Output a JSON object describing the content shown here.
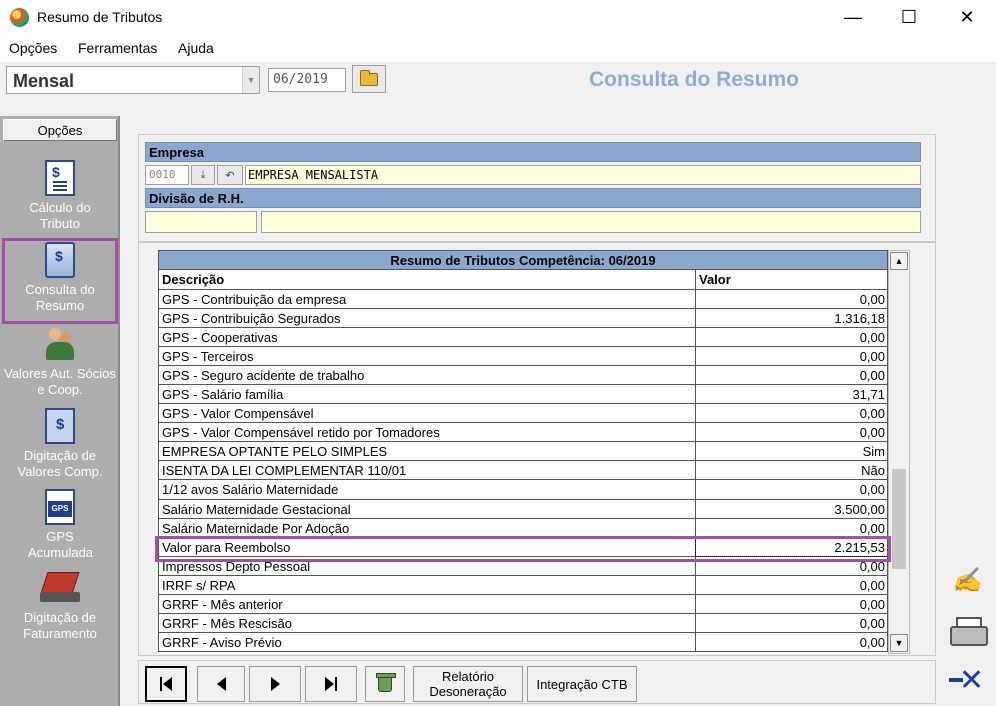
{
  "window": {
    "title": "Resumo de Tributos",
    "minimize": "—",
    "maximize": "☐",
    "close": "✕"
  },
  "menu": [
    "Opções",
    "Ferramentas",
    "Ajuda"
  ],
  "toolbar": {
    "period_type": "Mensal",
    "competence": "06/2019",
    "page_title": "Consulta do Resumo"
  },
  "sidebar": {
    "header": "Opções",
    "items": [
      {
        "label": "Cálculo do Tributo",
        "icon": "calc-tribute-icon"
      },
      {
        "label": "Consulta do Resumo",
        "icon": "consult-summary-icon",
        "selected": true
      },
      {
        "label": "Valores Aut. Sócios e Coop.",
        "icon": "partners-icon"
      },
      {
        "label": "Digitação de Valores Comp.",
        "icon": "compensation-entry-icon"
      },
      {
        "label": "GPS Acumulada",
        "icon": "gps-icon"
      },
      {
        "label": "Digitação de Faturamento",
        "icon": "billing-entry-icon"
      }
    ]
  },
  "form": {
    "empresa_label": "Empresa",
    "empresa_code": "0010",
    "empresa_name": "EMPRESA MENSALISTA",
    "divisao_label": "Divisão de R.H.",
    "divisao_code": "",
    "divisao_name": ""
  },
  "grid": {
    "caption": "Resumo de Tributos Competência: 06/2019",
    "columns": [
      "Descrição",
      "Valor"
    ],
    "rows": [
      {
        "desc": "GPS - Contribuição da empresa",
        "value": "0,00"
      },
      {
        "desc": "GPS - Contribuição Segurados",
        "value": "1.316,18"
      },
      {
        "desc": "GPS - Cooperativas",
        "value": "0,00"
      },
      {
        "desc": "GPS - Terceiros",
        "value": "0,00"
      },
      {
        "desc": "GPS - Seguro acidente de trabalho",
        "value": "0,00"
      },
      {
        "desc": "GPS - Salário família",
        "value": "31,71"
      },
      {
        "desc": "GPS - Valor Compensável",
        "value": "0,00"
      },
      {
        "desc": "GPS - Valor Compensável retido por Tomadores",
        "value": "0,00"
      },
      {
        "desc": "EMPRESA OPTANTE PELO SIMPLES",
        "value": "Sim"
      },
      {
        "desc": "ISENTA DA LEI COMPLEMENTAR 110/01",
        "value": "Não"
      },
      {
        "desc": "1/12 avos Salário Maternidade",
        "value": "0,00"
      },
      {
        "desc": "Salário Maternidade Gestacional",
        "value": "3.500,00"
      },
      {
        "desc": "Salário Maternidade Por Adoção",
        "value": "0,00"
      },
      {
        "desc": "Valor para Reembolso",
        "value": "2.215,53",
        "highlighted": true
      },
      {
        "desc": "Impressos Depto Pessoal",
        "value": "0,00"
      },
      {
        "desc": "IRRF s/ RPA",
        "value": "0,00"
      },
      {
        "desc": "GRRF - Mês anterior",
        "value": "0,00"
      },
      {
        "desc": "GRRF - Mês Rescisão",
        "value": "0,00"
      },
      {
        "desc": "GRRF - Aviso Prévio",
        "value": "0,00"
      }
    ]
  },
  "bottom": {
    "report_label": "Relatório Desoneração",
    "integration_label": "Integração CTB"
  },
  "colors": {
    "header_blue": "#8aa7cf",
    "title_blue": "#8eaed1",
    "highlight": "#a24fa8",
    "field_yellow": "#ffffdc"
  }
}
